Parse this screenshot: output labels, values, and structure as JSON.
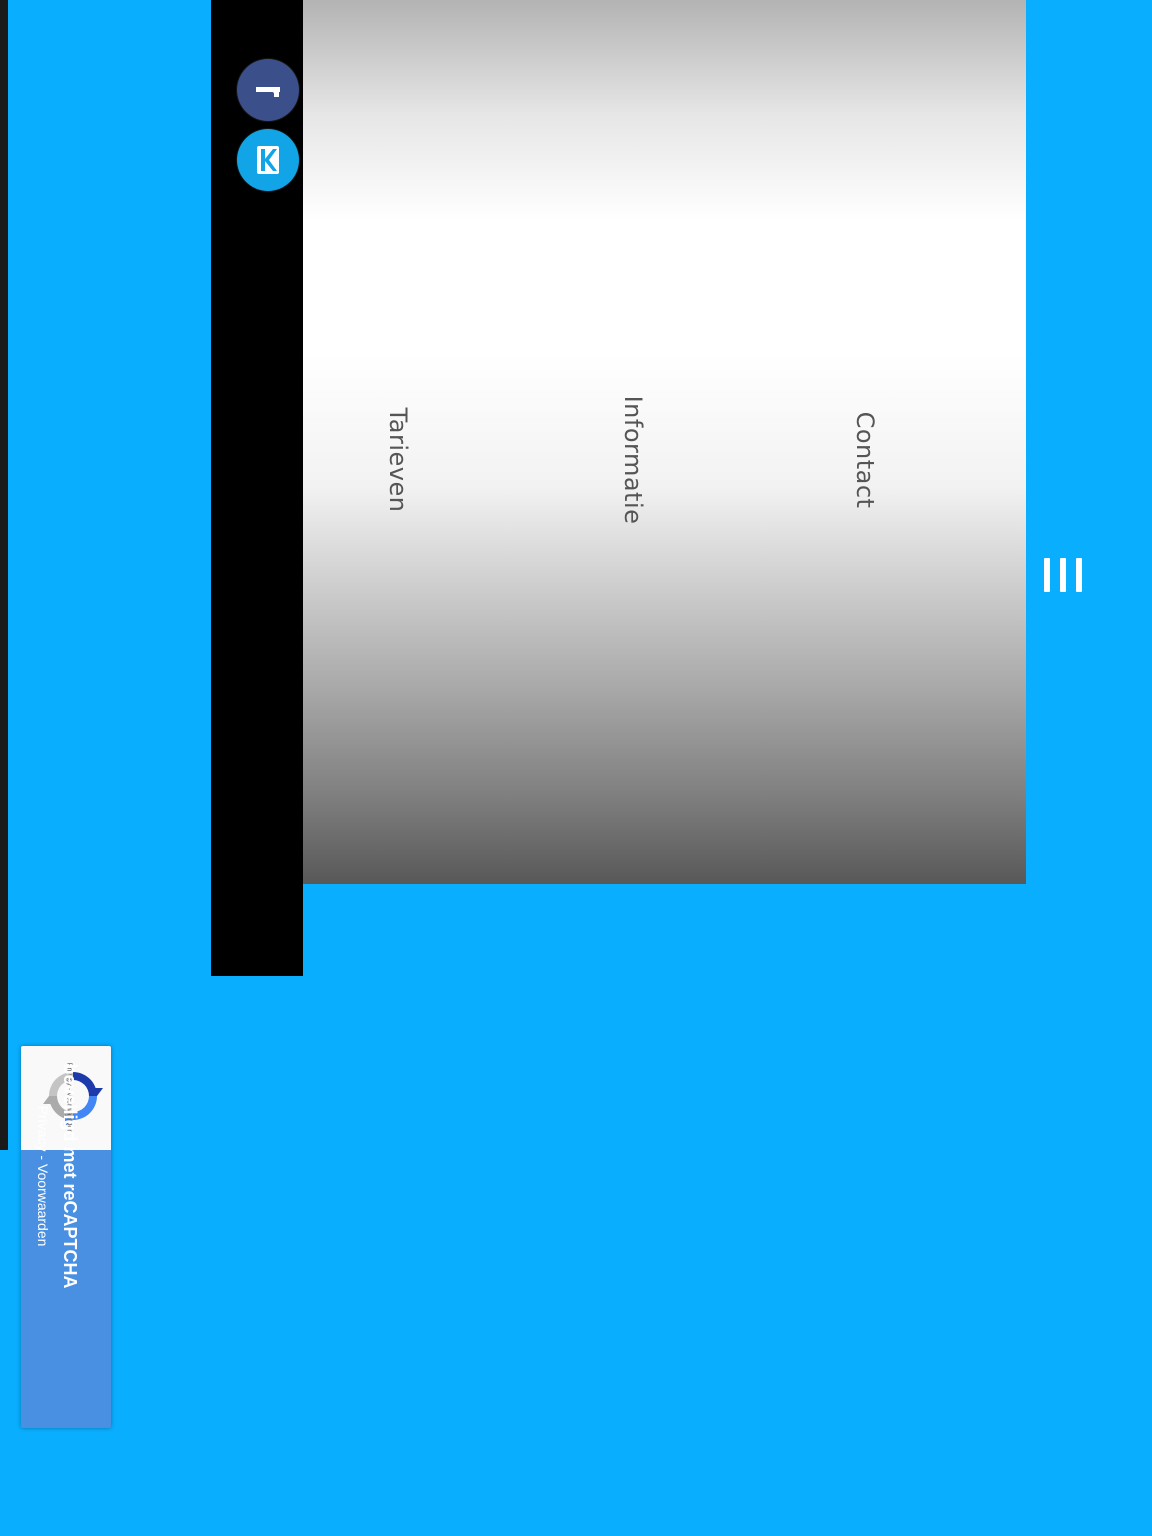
{
  "social": {
    "facebook_icon": "facebook-icon",
    "second_icon": "kontakt-icon"
  },
  "nav": {
    "items": [
      {
        "label": "Tarieven"
      },
      {
        "label": "Informatie"
      },
      {
        "label": "Contact"
      }
    ]
  },
  "menu": {
    "icon": "hamburger-menu-icon"
  },
  "recaptcha": {
    "title": "beveiligd met reCAPTCHA",
    "links": "Privacy - Voorwaarden",
    "small_links": "Privacy - Voorwaarden"
  },
  "colors": {
    "background": "#09aeff",
    "social_bar": "#000000",
    "facebook": "#3b4f8a",
    "second_social": "#11a4e6",
    "recaptcha_blue": "#4a90e2"
  }
}
